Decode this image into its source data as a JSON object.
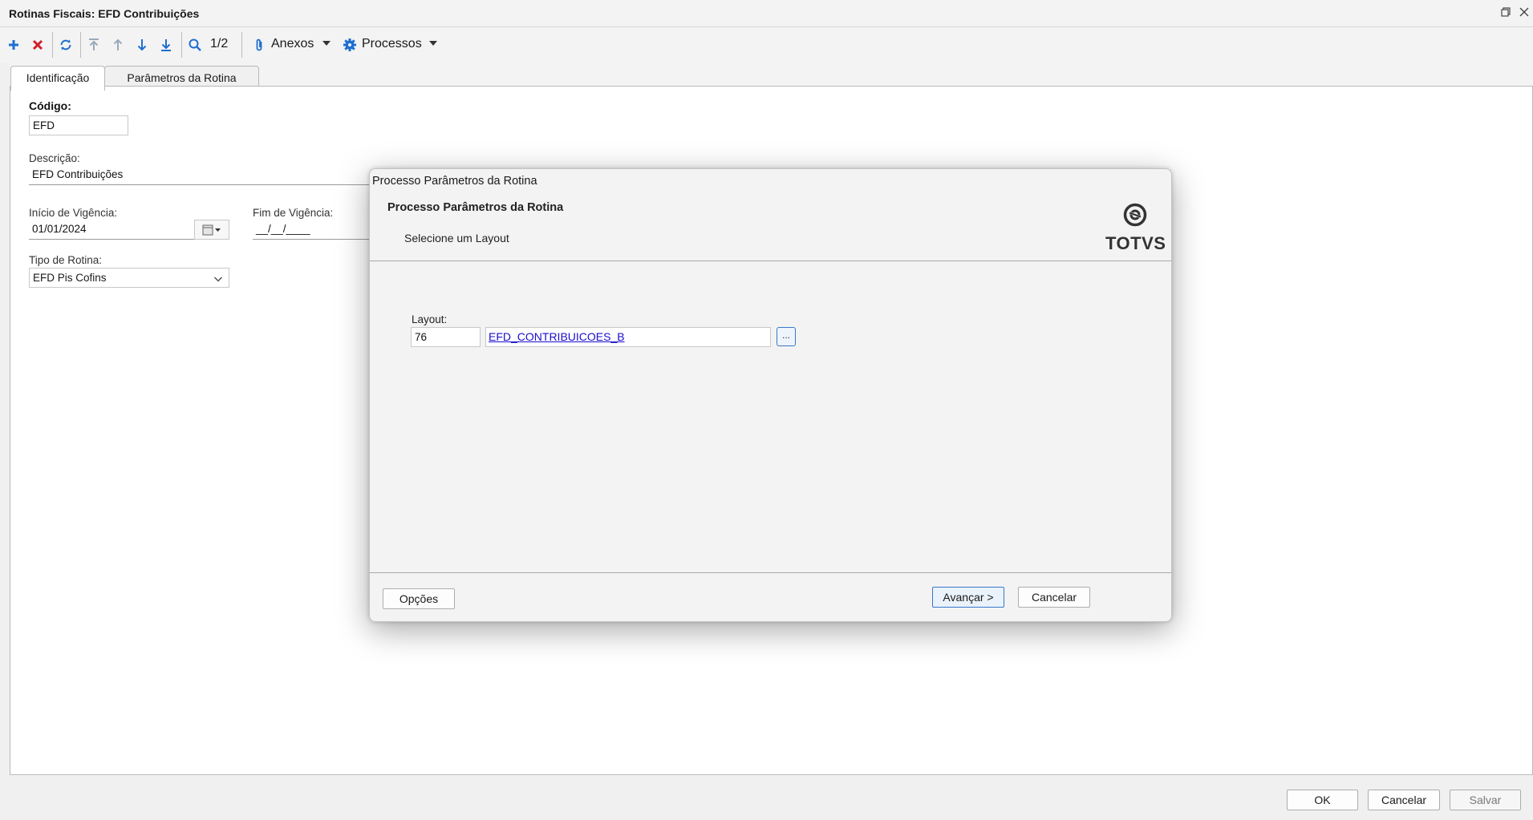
{
  "window": {
    "title": "Rotinas Fiscais: EFD Contribuições",
    "restore_icon": "restore-icon",
    "close_icon": "close-icon"
  },
  "toolbar": {
    "record_position": "1/2",
    "attachments_label": "Anexos",
    "processes_label": "Processos",
    "colors": {
      "add": "#1e6fd0",
      "delete": "#d0202a",
      "nav": "#1e6fd0",
      "disabled_nav": "#9aa9bd"
    }
  },
  "tabs": [
    {
      "label": "Identificação",
      "active": true
    },
    {
      "label": "Parâmetros da Rotina",
      "active": false
    }
  ],
  "form": {
    "codigo_label": "Código:",
    "codigo_value": "EFD",
    "descricao_label": "Descrição:",
    "descricao_value": "EFD Contribuições",
    "inicio_label": "Início de Vigência:",
    "inicio_value": "01/01/2024",
    "fim_label": "Fim de Vigência:",
    "fim_value": "__/__/____",
    "tipo_label": "Tipo de Rotina:",
    "tipo_value": "EFD Pis Cofins"
  },
  "dialog": {
    "window_title": "Processo Parâmetros da Rotina",
    "heading": "Processo Parâmetros da Rotina",
    "subtitle": "Selecione um Layout",
    "logo_text": "TOTVS",
    "layout_label": "Layout:",
    "layout_code": "76",
    "layout_name": "EFD_CONTRIBUICOES_B",
    "lookup_label": "...",
    "options_label": "Opções",
    "next_label": "Avançar >",
    "cancel_label": "Cancelar"
  },
  "footer": {
    "ok_label": "OK",
    "cancel_label": "Cancelar",
    "save_label": "Salvar"
  }
}
